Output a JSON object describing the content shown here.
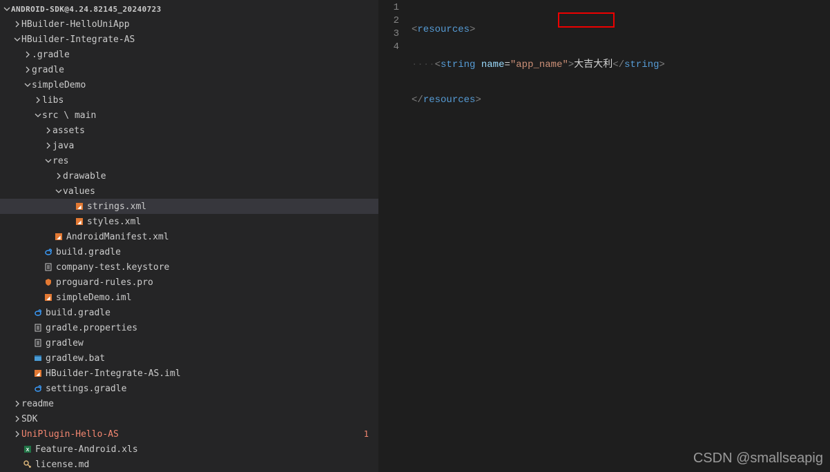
{
  "root": {
    "label": "ANDROID-SDK@4.24.82145_20240723"
  },
  "tree": [
    {
      "indent": 1,
      "chev": "right",
      "icon": "",
      "label": "HBuilder-HelloUniApp"
    },
    {
      "indent": 1,
      "chev": "down",
      "icon": "",
      "label": "HBuilder-Integrate-AS"
    },
    {
      "indent": 2,
      "chev": "right",
      "icon": "",
      "label": ".gradle"
    },
    {
      "indent": 2,
      "chev": "right",
      "icon": "",
      "label": "gradle"
    },
    {
      "indent": 2,
      "chev": "down",
      "icon": "",
      "label": "simpleDemo"
    },
    {
      "indent": 3,
      "chev": "right",
      "icon": "",
      "label": "libs"
    },
    {
      "indent": 3,
      "chev": "down",
      "icon": "",
      "label": "src \\ main"
    },
    {
      "indent": 4,
      "chev": "right",
      "icon": "",
      "label": "assets"
    },
    {
      "indent": 4,
      "chev": "right",
      "icon": "",
      "label": "java"
    },
    {
      "indent": 4,
      "chev": "down",
      "icon": "",
      "label": "res"
    },
    {
      "indent": 5,
      "chev": "right",
      "icon": "",
      "label": "drawable"
    },
    {
      "indent": 5,
      "chev": "down",
      "icon": "",
      "label": "values"
    },
    {
      "indent": 6,
      "chev": "",
      "icon": "xml",
      "label": "strings.xml",
      "selected": true
    },
    {
      "indent": 6,
      "chev": "",
      "icon": "xml",
      "label": "styles.xml"
    },
    {
      "indent": 4,
      "chev": "",
      "icon": "xml",
      "label": "AndroidManifest.xml"
    },
    {
      "indent": 3,
      "chev": "",
      "icon": "gradle",
      "label": "build.gradle"
    },
    {
      "indent": 3,
      "chev": "",
      "icon": "file",
      "label": "company-test.keystore"
    },
    {
      "indent": 3,
      "chev": "",
      "icon": "shield",
      "label": "proguard-rules.pro"
    },
    {
      "indent": 3,
      "chev": "",
      "icon": "xml",
      "label": "simpleDemo.iml"
    },
    {
      "indent": 2,
      "chev": "",
      "icon": "gradle",
      "label": "build.gradle"
    },
    {
      "indent": 2,
      "chev": "",
      "icon": "file",
      "label": "gradle.properties"
    },
    {
      "indent": 2,
      "chev": "",
      "icon": "file",
      "label": "gradlew"
    },
    {
      "indent": 2,
      "chev": "",
      "icon": "bat",
      "label": "gradlew.bat"
    },
    {
      "indent": 2,
      "chev": "",
      "icon": "xml",
      "label": "HBuilder-Integrate-AS.iml"
    },
    {
      "indent": 2,
      "chev": "",
      "icon": "gradle",
      "label": "settings.gradle"
    },
    {
      "indent": 1,
      "chev": "right",
      "icon": "",
      "label": "readme"
    },
    {
      "indent": 1,
      "chev": "right",
      "icon": "",
      "label": "SDK"
    },
    {
      "indent": 1,
      "chev": "right",
      "icon": "",
      "label": "UniPlugin-Hello-AS",
      "status": "error",
      "badge": "1"
    },
    {
      "indent": 1,
      "chev": "",
      "icon": "xls",
      "label": "Feature-Android.xls"
    },
    {
      "indent": 1,
      "chev": "",
      "icon": "license",
      "label": "license.md"
    }
  ],
  "code": {
    "line1": {
      "tag": "resources"
    },
    "line2": {
      "tag": "string",
      "attr": "name",
      "val": "\"app_name\"",
      "content": "大吉大利"
    },
    "line3": {
      "tag": "resources"
    }
  },
  "lineNums": [
    "1",
    "2",
    "3",
    "4"
  ],
  "watermark": "CSDN @smallseapig"
}
